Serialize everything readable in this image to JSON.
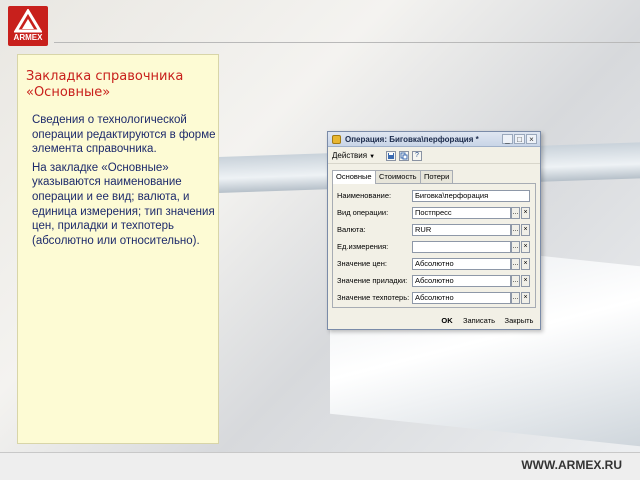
{
  "brand": {
    "logo_text": "ARMEX",
    "site": "WWW.ARMEX.RU"
  },
  "slide": {
    "title": "Закладка справочника «Основные»",
    "paragraphs": [
      "Сведения о технологической операции редактируются в форме элемента справочника.",
      "На закладке «Основные» указываются наименование операции и ее вид; валюта, и единица измерения; тип значения цен, приладки и техпотерь (абсолютно или относительно)."
    ]
  },
  "window": {
    "title": "Операция: Биговка\\перфорация *",
    "buttons": {
      "minimize": "_",
      "maximize": "□",
      "close": "×"
    },
    "toolbar": {
      "actions_label": "Действия",
      "icons": [
        "save-icon",
        "copy-icon",
        "help-icon"
      ],
      "help_glyph": "?"
    },
    "tabs": [
      "Основные",
      "Стоимость",
      "Потери"
    ],
    "active_tab": 0,
    "fields": [
      {
        "label": "Наименование:",
        "value": "Биговка\\перфорация",
        "select": false,
        "clear": false
      },
      {
        "label": "Вид операции:",
        "value": "Постпресс",
        "select": true,
        "clear": true
      },
      {
        "label": "Валюта:",
        "value": "RUR",
        "select": true,
        "clear": true
      },
      {
        "label": "Ед.измерения:",
        "value": "",
        "select": true,
        "clear": true
      },
      {
        "label": "Значение цен:",
        "value": "Абсолютно",
        "select": true,
        "clear": true
      },
      {
        "label": "Значение приладки:",
        "value": "Абсолютно",
        "select": true,
        "clear": true
      },
      {
        "label": "Значение техпотерь:",
        "value": "Абсолютно",
        "select": true,
        "clear": true
      }
    ],
    "select_glyph": "...",
    "clear_glyph": "×",
    "footer": {
      "ok": "OK",
      "save": "Записать",
      "close": "Закрыть"
    }
  },
  "colors": {
    "title_red": "#c8201c",
    "text_blue": "#1d2a6b",
    "panel_bg": "#fdfbd4"
  }
}
